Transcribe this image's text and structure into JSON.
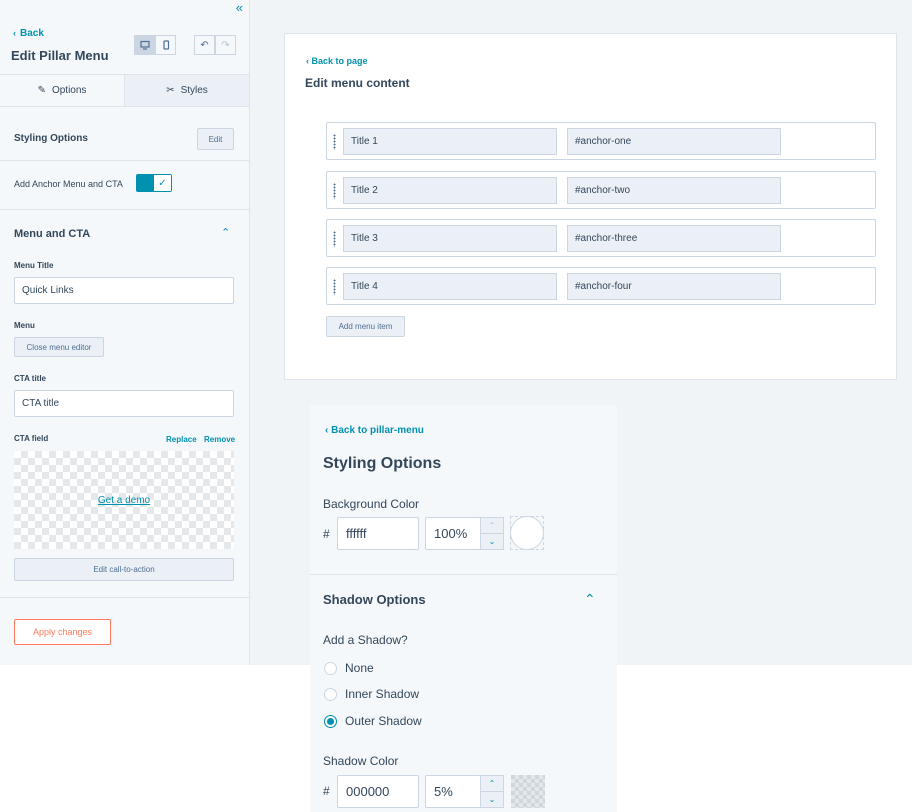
{
  "sidebar": {
    "back_label": "Back",
    "title": "Edit Pillar Menu",
    "tabs": [
      {
        "label": "Options",
        "icon": "pencil-icon"
      },
      {
        "label": "Styles",
        "icon": "brush-icon"
      }
    ],
    "styling_options": {
      "label": "Styling Options",
      "edit_label": "Edit"
    },
    "anchor_toggle": {
      "label": "Add Anchor Menu and CTA",
      "on": true
    },
    "menu_section": {
      "title": "Menu and CTA",
      "menu_title_label": "Menu Title",
      "menu_title_value": "Quick Links",
      "menu_label": "Menu",
      "close_editor_label": "Close menu editor",
      "cta_title_label": "CTA title",
      "cta_title_value": "CTA title",
      "cta_field_label": "CTA field",
      "replace_label": "Replace",
      "remove_label": "Remove",
      "cta_preview_text": "Get a demo",
      "edit_cta_label": "Edit call-to-action"
    },
    "apply_label": "Apply changes"
  },
  "menu_editor": {
    "back_label": "Back to page",
    "title": "Edit menu content",
    "items": [
      {
        "title": "Title 1",
        "anchor": "#anchor-one"
      },
      {
        "title": "Title 2",
        "anchor": "#anchor-two"
      },
      {
        "title": "Title 3",
        "anchor": "#anchor-three"
      },
      {
        "title": "Title 4",
        "anchor": "#anchor-four"
      }
    ],
    "add_label": "Add menu item"
  },
  "styling_panel": {
    "back_label": "Back to pillar-menu",
    "title": "Styling Options",
    "background_color_label": "Background Color",
    "background_hex": "ffffff",
    "background_opacity": "100%",
    "shadow_title": "Shadow Options",
    "add_shadow_label": "Add a Shadow?",
    "shadow_options": [
      "None",
      "Inner Shadow",
      "Outer Shadow"
    ],
    "shadow_selected": "Outer Shadow",
    "shadow_color_label": "Shadow Color",
    "shadow_hex": "000000",
    "shadow_opacity": "5%",
    "hash": "#"
  },
  "colors": {
    "accent": "#0091ae",
    "apply": "#ff7a59",
    "text": "#33475b"
  }
}
